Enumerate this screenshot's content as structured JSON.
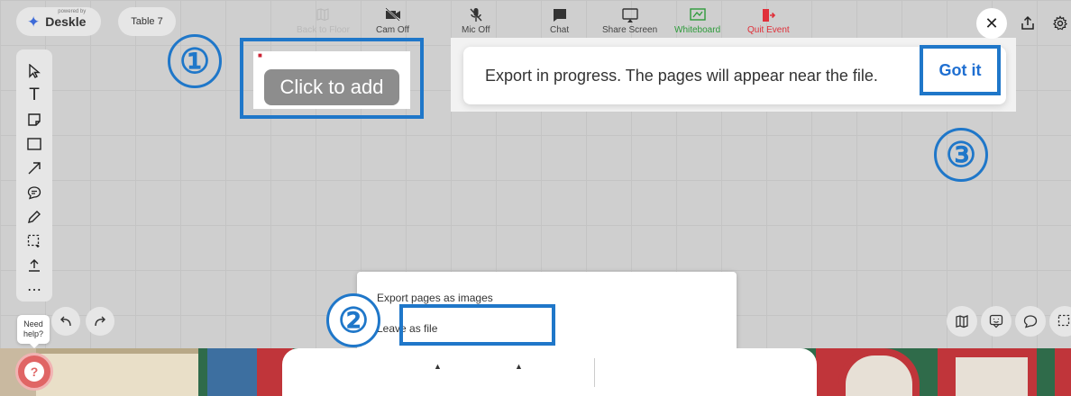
{
  "header": {
    "logo_tagline": "powered by",
    "logo_text": "Deskle",
    "table_name": "Table 7"
  },
  "annotations": {
    "one": "①",
    "two": "②",
    "three": "③"
  },
  "card": {
    "click_to_add": "Click to add"
  },
  "toast": {
    "message": "Export in progress. The pages will appear near the file.",
    "action": "Got it"
  },
  "export_menu": {
    "items": [
      "Export pages as images",
      "Leave as file"
    ]
  },
  "help": {
    "bubble": "Need help?",
    "button": "?"
  },
  "bottom_bar": {
    "items": [
      {
        "label": "Back to Floor",
        "icon": "map-icon"
      },
      {
        "label": "Cam Off",
        "icon": "camera-off-icon"
      },
      {
        "label": "Mic Off",
        "icon": "mic-off-icon"
      },
      {
        "label": "Chat",
        "icon": "chat-icon"
      },
      {
        "label": "Share Screen",
        "icon": "share-screen-icon"
      },
      {
        "label": "Whiteboard",
        "icon": "whiteboard-icon"
      },
      {
        "label": "Quit Event",
        "icon": "exit-icon"
      }
    ]
  },
  "colors": {
    "annotation_blue": "#1f77c9",
    "link_blue": "#1f6fd1",
    "whiteboard_green": "#2d9b3a",
    "quit_red": "#e0303a"
  }
}
